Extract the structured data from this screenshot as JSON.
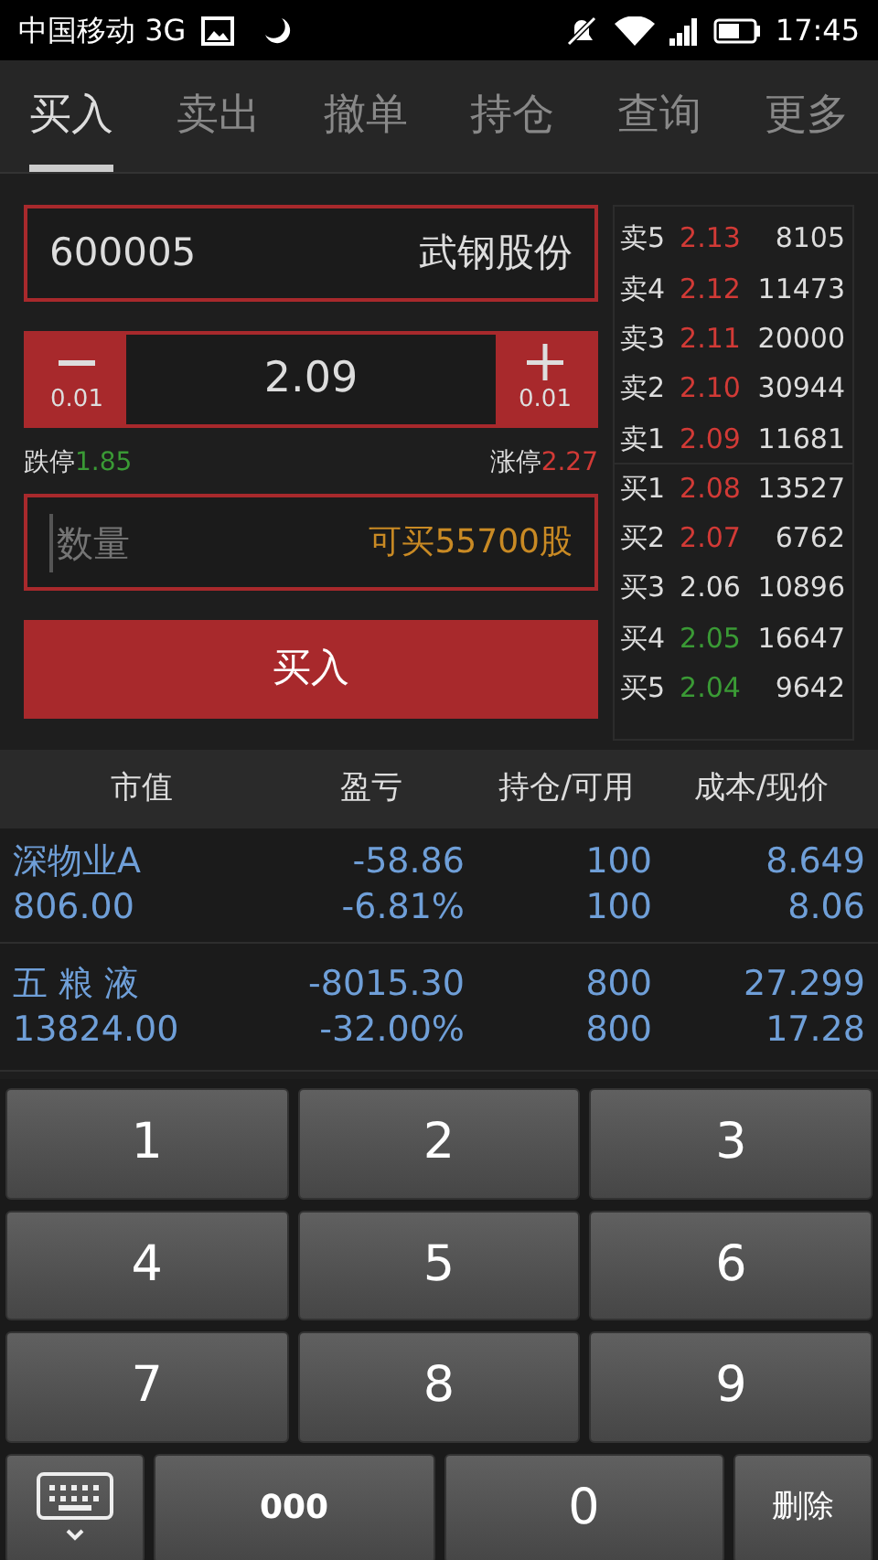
{
  "status_bar": {
    "carrier": "中国移动 3G",
    "time": "17:45"
  },
  "tabs": [
    {
      "label": "买入",
      "selected": true
    },
    {
      "label": "卖出",
      "selected": false
    },
    {
      "label": "撤单",
      "selected": false
    },
    {
      "label": "持仓",
      "selected": false
    },
    {
      "label": "查询",
      "selected": false
    },
    {
      "label": "更多",
      "selected": false
    }
  ],
  "stock": {
    "code": "600005",
    "name": "武钢股份"
  },
  "price": {
    "value": "2.09",
    "minus_step": "0.01",
    "plus_step": "0.01"
  },
  "limits": {
    "down_label": "跌停",
    "down_value": "1.85",
    "up_label": "涨停",
    "up_value": "2.27"
  },
  "quantity": {
    "placeholder": "数量",
    "available": "可买55700股"
  },
  "buy_button": "买入",
  "order_book": [
    {
      "label": "卖5",
      "price": "2.13",
      "volume": "8105",
      "color": "#d23a36"
    },
    {
      "label": "卖4",
      "price": "2.12",
      "volume": "11473",
      "color": "#d23a36"
    },
    {
      "label": "卖3",
      "price": "2.11",
      "volume": "20000",
      "color": "#d23a36"
    },
    {
      "label": "卖2",
      "price": "2.10",
      "volume": "30944",
      "color": "#d23a36"
    },
    {
      "label": "卖1",
      "price": "2.09",
      "volume": "11681",
      "color": "#d23a36"
    },
    {
      "label": "买1",
      "price": "2.08",
      "volume": "13527",
      "color": "#d23a36"
    },
    {
      "label": "买2",
      "price": "2.07",
      "volume": "6762",
      "color": "#d23a36"
    },
    {
      "label": "买3",
      "price": "2.06",
      "volume": "10896",
      "color": "#dddddd"
    },
    {
      "label": "买4",
      "price": "2.05",
      "volume": "16647",
      "color": "#3a9a35"
    },
    {
      "label": "买5",
      "price": "2.04",
      "volume": "9642",
      "color": "#3a9a35"
    }
  ],
  "positions": {
    "columns": [
      "市值",
      "盈亏",
      "持仓/可用",
      "成本/现价"
    ],
    "rows": [
      {
        "name": "深物业A",
        "market_value": "806.00",
        "pnl": "-58.86",
        "pnl_pct": "-6.81%",
        "hold": "100",
        "avail": "100",
        "cost": "8.649",
        "current": "8.06"
      },
      {
        "name": "五 粮 液",
        "market_value": "13824.00",
        "pnl": "-8015.30",
        "pnl_pct": "-32.00%",
        "hold": "800",
        "avail": "800",
        "cost": "27.299",
        "current": "17.28"
      }
    ]
  },
  "keypad": [
    {
      "kind": "digit",
      "label": "1"
    },
    {
      "kind": "digit",
      "label": "2"
    },
    {
      "kind": "digit",
      "label": "3"
    },
    {
      "kind": "digit",
      "label": "4"
    },
    {
      "kind": "digit",
      "label": "5"
    },
    {
      "kind": "digit",
      "label": "6"
    },
    {
      "kind": "digit",
      "label": "7"
    },
    {
      "kind": "digit",
      "label": "8"
    },
    {
      "kind": "digit",
      "label": "9"
    },
    {
      "kind": "hide"
    },
    {
      "kind": "small",
      "label": "000"
    },
    {
      "kind": "digit",
      "label": "0"
    },
    {
      "kind": "delete",
      "label": "删除"
    }
  ]
}
